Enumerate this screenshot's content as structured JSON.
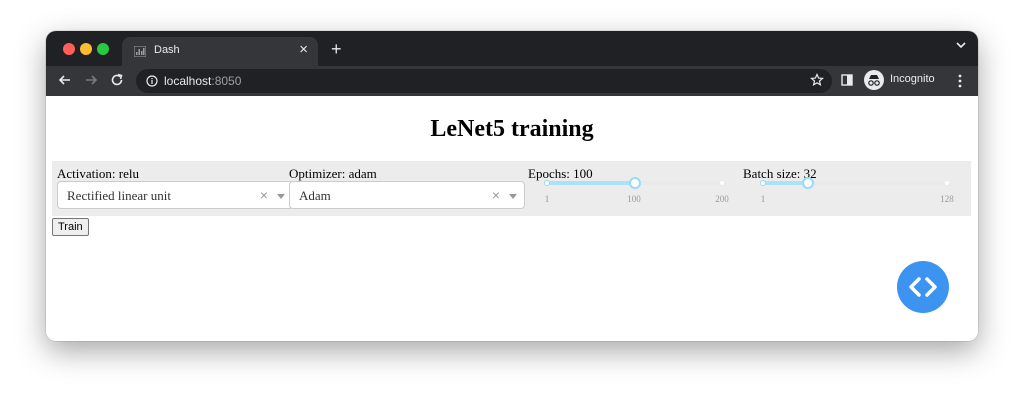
{
  "browser": {
    "tab_title": "Dash",
    "tab_close": "×",
    "new_tab": "+",
    "url_host": "localhost",
    "url_port": ":8050",
    "profile_label": "Incognito",
    "colors": {
      "frame": "#202124",
      "toolbar": "#35363a",
      "close": "#ff5f57",
      "minimize": "#febc2e",
      "maximize": "#28c840"
    }
  },
  "page": {
    "title": "LeNet5 training",
    "activation": {
      "label": "Activation: relu",
      "value": "Rectified linear unit",
      "clear": "×"
    },
    "optimizer": {
      "label": "Optimizer: adam",
      "value": "Adam",
      "clear": "×"
    },
    "epochs": {
      "label": "Epochs: 100",
      "min": 1,
      "max": 200,
      "value": 100,
      "marks": [
        "1",
        "100",
        "200"
      ]
    },
    "batch_size": {
      "label": "Batch size: 32",
      "min": 1,
      "max": 128,
      "value": 32,
      "marks": [
        "1",
        "128"
      ]
    },
    "train_button": "Train",
    "colors": {
      "panel": "#ececec",
      "slider_track": "#abe2fb",
      "slider_handle": "#96dbfa",
      "debug_button": "#3c94f0"
    }
  }
}
